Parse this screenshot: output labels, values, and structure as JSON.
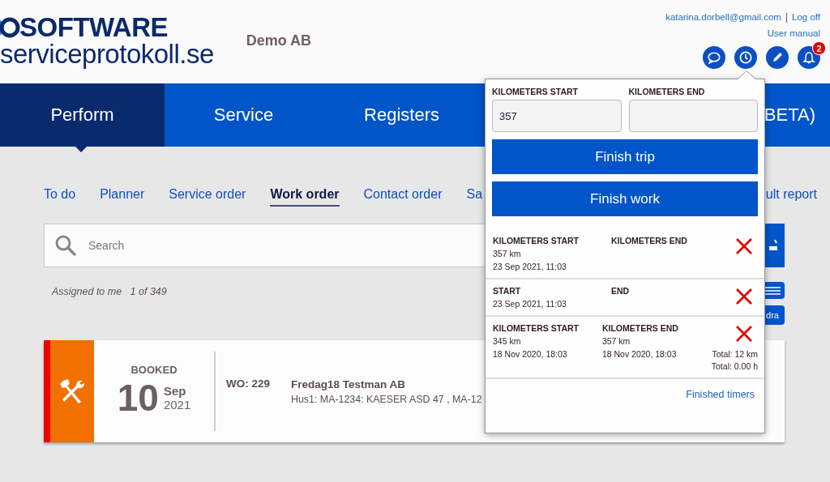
{
  "header": {
    "logo_top": "SOFTWARE",
    "logo_bottom": "serviceprotokoll.se",
    "company": "Demo AB",
    "user_email": "katarina.dorbell@gmail.com",
    "separator": "|",
    "logoff": "Log off",
    "manual": "User manual",
    "icon_buttons": [
      {
        "kind": "chat"
      },
      {
        "kind": "clock"
      },
      {
        "kind": "pencil"
      },
      {
        "kind": "bell",
        "badge": "2"
      }
    ]
  },
  "nav": [
    {
      "label": "Perform",
      "selected": true
    },
    {
      "label": "Service",
      "selected": false
    },
    {
      "label": "Registers",
      "selected": false
    },
    {
      "label": "BETA)",
      "selected": false
    }
  ],
  "tabs": [
    {
      "label": "To do",
      "selected": false
    },
    {
      "label": "Planner",
      "selected": false
    },
    {
      "label": "Service order",
      "selected": false
    },
    {
      "label": "Work order",
      "selected": true
    },
    {
      "label": "Contact order",
      "selected": false
    },
    {
      "label": "Sa",
      "selected": false
    },
    {
      "label": "ult report",
      "selected": false
    }
  ],
  "search": {
    "placeholder": "Search"
  },
  "filter_label": "Assigned to me",
  "count": "1 of 349",
  "side_buttons": [
    {
      "kind": "menu"
    },
    {
      "kind": "text",
      "label": "dra"
    }
  ],
  "work_orders": [
    {
      "status": "BOOKED",
      "day": "10",
      "month": "Sep",
      "year": "2021",
      "number": "WO: 229",
      "customer": "Fredag18 Testman AB",
      "details": "Hus1: MA-1234: KAESER ASD 47 , MA-12"
    }
  ],
  "timer_popup": {
    "fields": [
      {
        "label": "KILOMETERS START",
        "value": "357"
      },
      {
        "label": "KILOMETERS END"
      }
    ],
    "actions": [
      "Finish trip",
      "Finish work"
    ],
    "entries": [
      {
        "start_label": "KILOMETERS START",
        "start_value": "357 km",
        "start_time": "23 Sep 2021, 11:03",
        "end_label": "KILOMETERS END"
      },
      {
        "start_label": "START",
        "start_time": "23 Sep 2021, 11:03",
        "end_label": "END"
      },
      {
        "start_label": "KILOMETERS START",
        "start_value": "345 km",
        "start_time": "18 Nov 2020, 18:03",
        "end_label": "KILOMETERS END",
        "end_value": "357 km",
        "end_time": "18 Nov 2020, 18:03",
        "totals": [
          "Total: 12 km",
          "Total: 0.00 h"
        ]
      }
    ],
    "footer_link": "Finished timers"
  }
}
